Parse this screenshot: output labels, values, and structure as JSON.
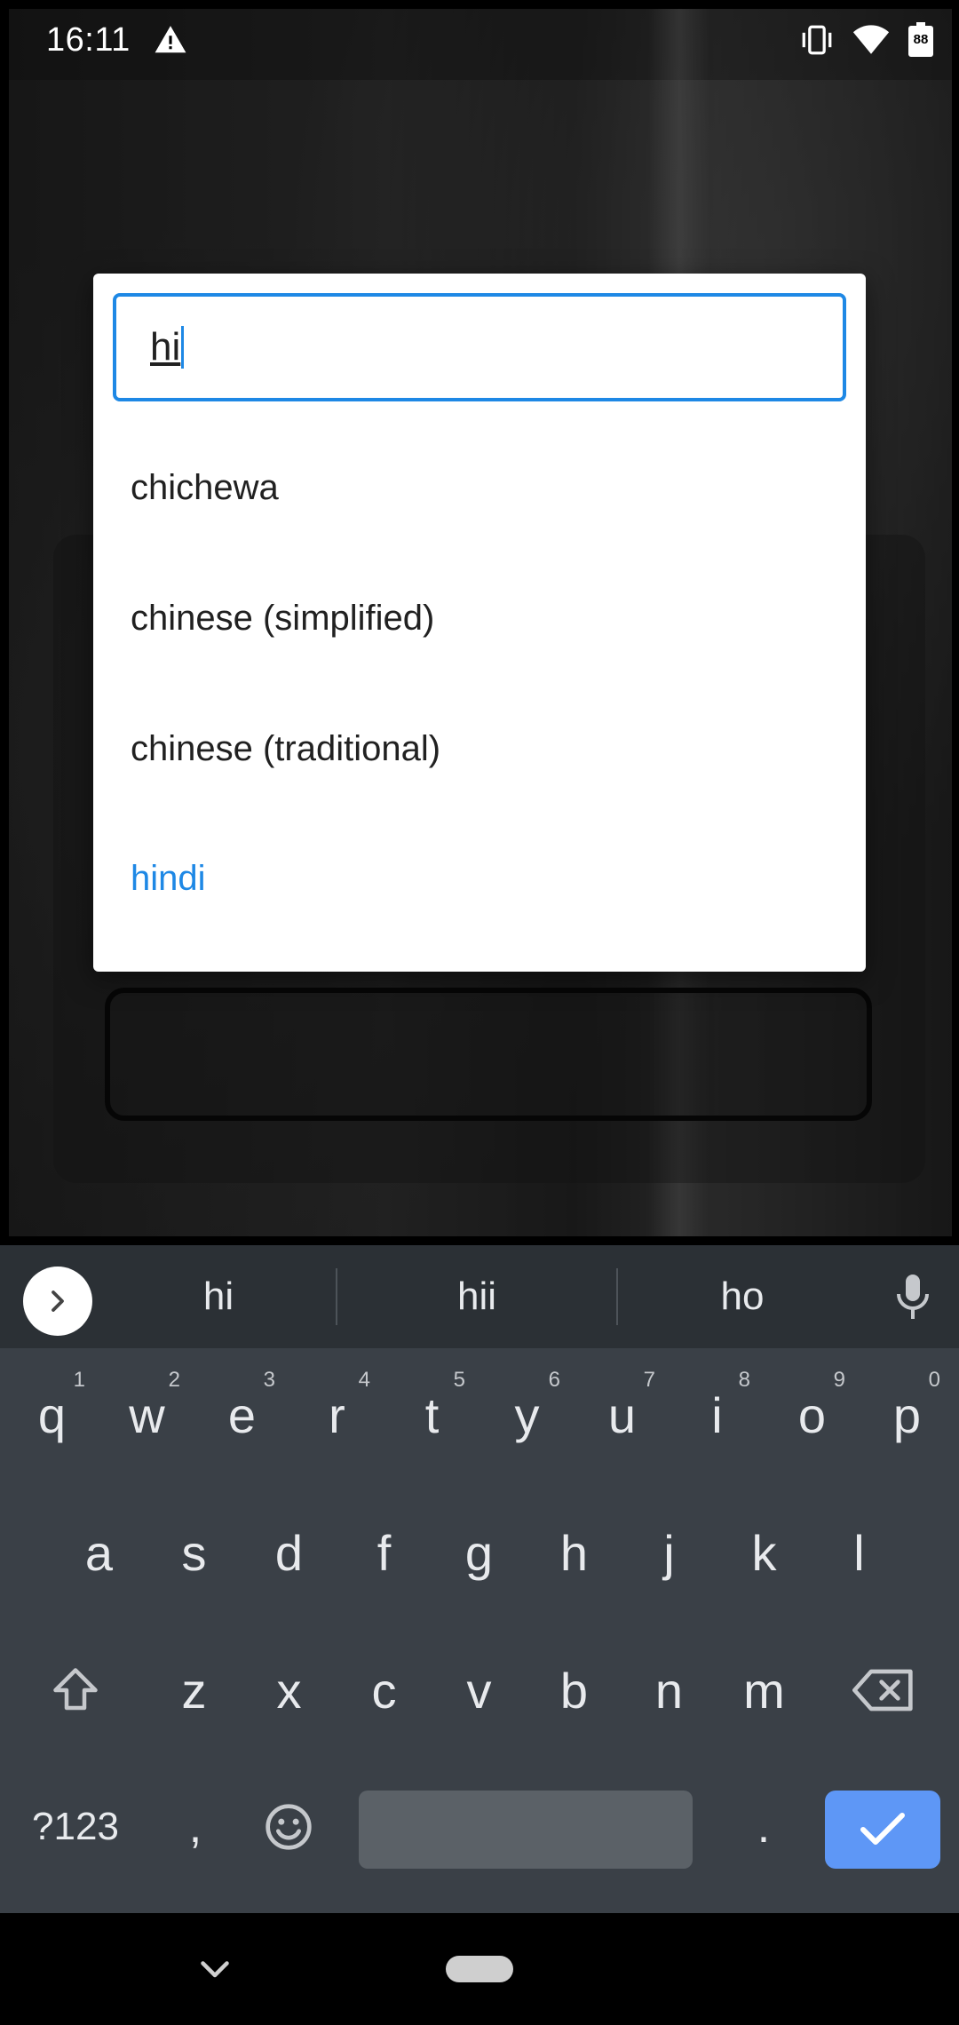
{
  "status_bar": {
    "time": "16:11",
    "battery": "88"
  },
  "dialog": {
    "search_value": "hi",
    "options": [
      {
        "label": "chichewa",
        "selected": false
      },
      {
        "label": "chinese (simplified)",
        "selected": false
      },
      {
        "label": "chinese (traditional)",
        "selected": false
      },
      {
        "label": "hindi",
        "selected": true
      }
    ]
  },
  "keyboard": {
    "suggestions": [
      "hi",
      "hii",
      "ho"
    ],
    "row1": [
      {
        "key": "q",
        "hint": "1"
      },
      {
        "key": "w",
        "hint": "2"
      },
      {
        "key": "e",
        "hint": "3"
      },
      {
        "key": "r",
        "hint": "4"
      },
      {
        "key": "t",
        "hint": "5"
      },
      {
        "key": "y",
        "hint": "6"
      },
      {
        "key": "u",
        "hint": "7"
      },
      {
        "key": "i",
        "hint": "8"
      },
      {
        "key": "o",
        "hint": "9"
      },
      {
        "key": "p",
        "hint": "0"
      }
    ],
    "row2": [
      "a",
      "s",
      "d",
      "f",
      "g",
      "h",
      "j",
      "k",
      "l"
    ],
    "row3": [
      "z",
      "x",
      "c",
      "v",
      "b",
      "n",
      "m"
    ],
    "symbols_label": "?123",
    "comma_label": ",",
    "period_label": ".",
    "accent_color": "#5e97f6"
  },
  "colors": {
    "accent": "#1e88e5",
    "keyboard_bg": "#3a4047"
  }
}
